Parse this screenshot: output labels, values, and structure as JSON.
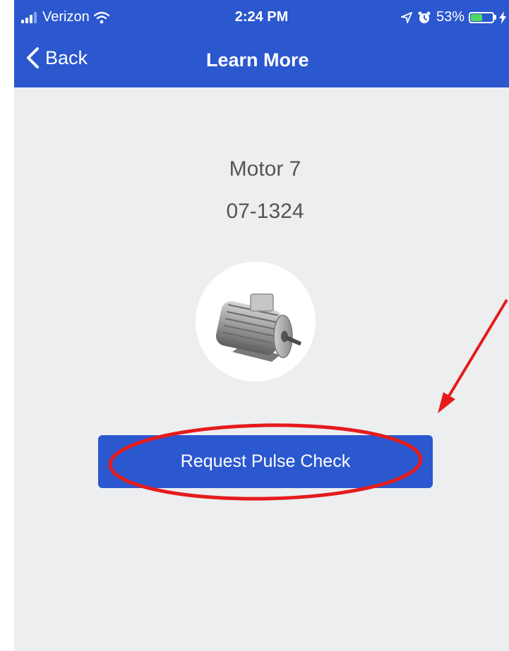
{
  "status_bar": {
    "carrier": "Verizon",
    "time": "2:24 PM",
    "battery_percent": "53%",
    "battery_level": 0.53,
    "icons": [
      "signal-icon",
      "wifi-icon",
      "location-arrow-icon",
      "alarm-icon",
      "battery-icon",
      "charging-icon"
    ]
  },
  "nav": {
    "back_label": "Back",
    "title": "Learn More"
  },
  "asset": {
    "name": "Motor 7",
    "id": "07-1324",
    "image_icon": "electric-motor-icon"
  },
  "actions": {
    "request_label": "Request Pulse Check"
  },
  "colors": {
    "brand_blue": "#2b57cf",
    "background": "#eceef0",
    "annotation_red": "#e51b1b",
    "battery_green": "#4cd964"
  }
}
